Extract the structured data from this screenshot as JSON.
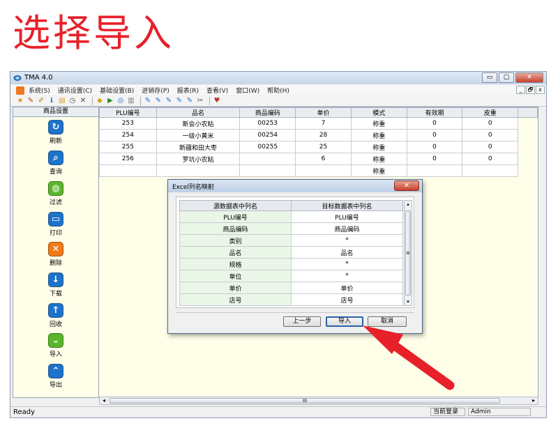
{
  "headline": "选择导入",
  "window": {
    "title": "TMA 4.0",
    "controls": {
      "minimize": "▭",
      "maximize": "▢",
      "close": "✕"
    }
  },
  "menu": {
    "items": [
      "系统(S)",
      "通讯设置(C)",
      "基础设置(B)",
      "进销存(P)",
      "报表(R)",
      "查看(V)",
      "窗口(W)",
      "帮助(H)"
    ],
    "mdi": {
      "minimize": "_",
      "restore": "🗗",
      "close": "x"
    }
  },
  "toolbar": {
    "icons": [
      "★",
      "✎",
      "✐",
      "ℹ",
      "▤",
      "◷",
      "✕",
      "◆",
      "▶",
      "◎",
      "▥",
      "✎",
      "✎",
      "✎",
      "✎",
      "✎",
      "✂",
      "♥"
    ]
  },
  "sidebar": {
    "title": "商品设置",
    "items": [
      {
        "label": "刷新",
        "icon": "↻",
        "color": "#1c73c9"
      },
      {
        "label": "查询",
        "icon": "⌕",
        "color": "#1c73c9"
      },
      {
        "label": "过滤",
        "icon": "◍",
        "color": "#5bb52b"
      },
      {
        "label": "打印",
        "icon": "▭",
        "color": "#1c73c9"
      },
      {
        "label": "删除",
        "icon": "✕",
        "color": "#ef7a1a"
      },
      {
        "label": "下载",
        "icon": "↓",
        "color": "#1c73c9"
      },
      {
        "label": "回收",
        "icon": "↑",
        "color": "#1c73c9"
      },
      {
        "label": "导入",
        "icon": "⌄",
        "color": "#5bb52b"
      },
      {
        "label": "导出",
        "icon": "⌃",
        "color": "#1c73c9"
      }
    ]
  },
  "grid": {
    "columns": [
      "PLU编号",
      "品名",
      "商品编码",
      "单价",
      "模式",
      "有效期",
      "皮重"
    ],
    "rows": [
      [
        "253",
        "新会小农粘",
        "00253",
        "7",
        "称重",
        "0",
        "0"
      ],
      [
        "254",
        "一级小黄米",
        "00254",
        "28",
        "称重",
        "0",
        "0"
      ],
      [
        "255",
        "新疆和田大枣",
        "00255",
        "25",
        "称重",
        "0",
        "0"
      ],
      [
        "256",
        "罗坑小农粘",
        "",
        "6",
        "称重",
        "0",
        "0"
      ],
      [
        "",
        "",
        "",
        "",
        "称重",
        "",
        ""
      ]
    ],
    "hscroll_grip": "III"
  },
  "status": {
    "text": "Ready",
    "login_label": "当前登录",
    "user": "Admin"
  },
  "dialog": {
    "title": "Excel列名映射",
    "close": "✕",
    "columns": [
      "源数据表中列名",
      "目标数据表中列名"
    ],
    "rows": [
      [
        "PLU编号",
        "PLU编号"
      ],
      [
        "商品编码",
        "商品编码"
      ],
      [
        "类别",
        "*"
      ],
      [
        "品名",
        "品名"
      ],
      [
        "规格",
        "*"
      ],
      [
        "单位",
        "*"
      ],
      [
        "单价",
        "单价"
      ],
      [
        "店号",
        "店号"
      ]
    ],
    "scroll_grip": "≡",
    "buttons": {
      "prev": "上一步",
      "import": "导入",
      "cancel": "取消"
    }
  },
  "annotation": {
    "color": "#e8202a"
  }
}
